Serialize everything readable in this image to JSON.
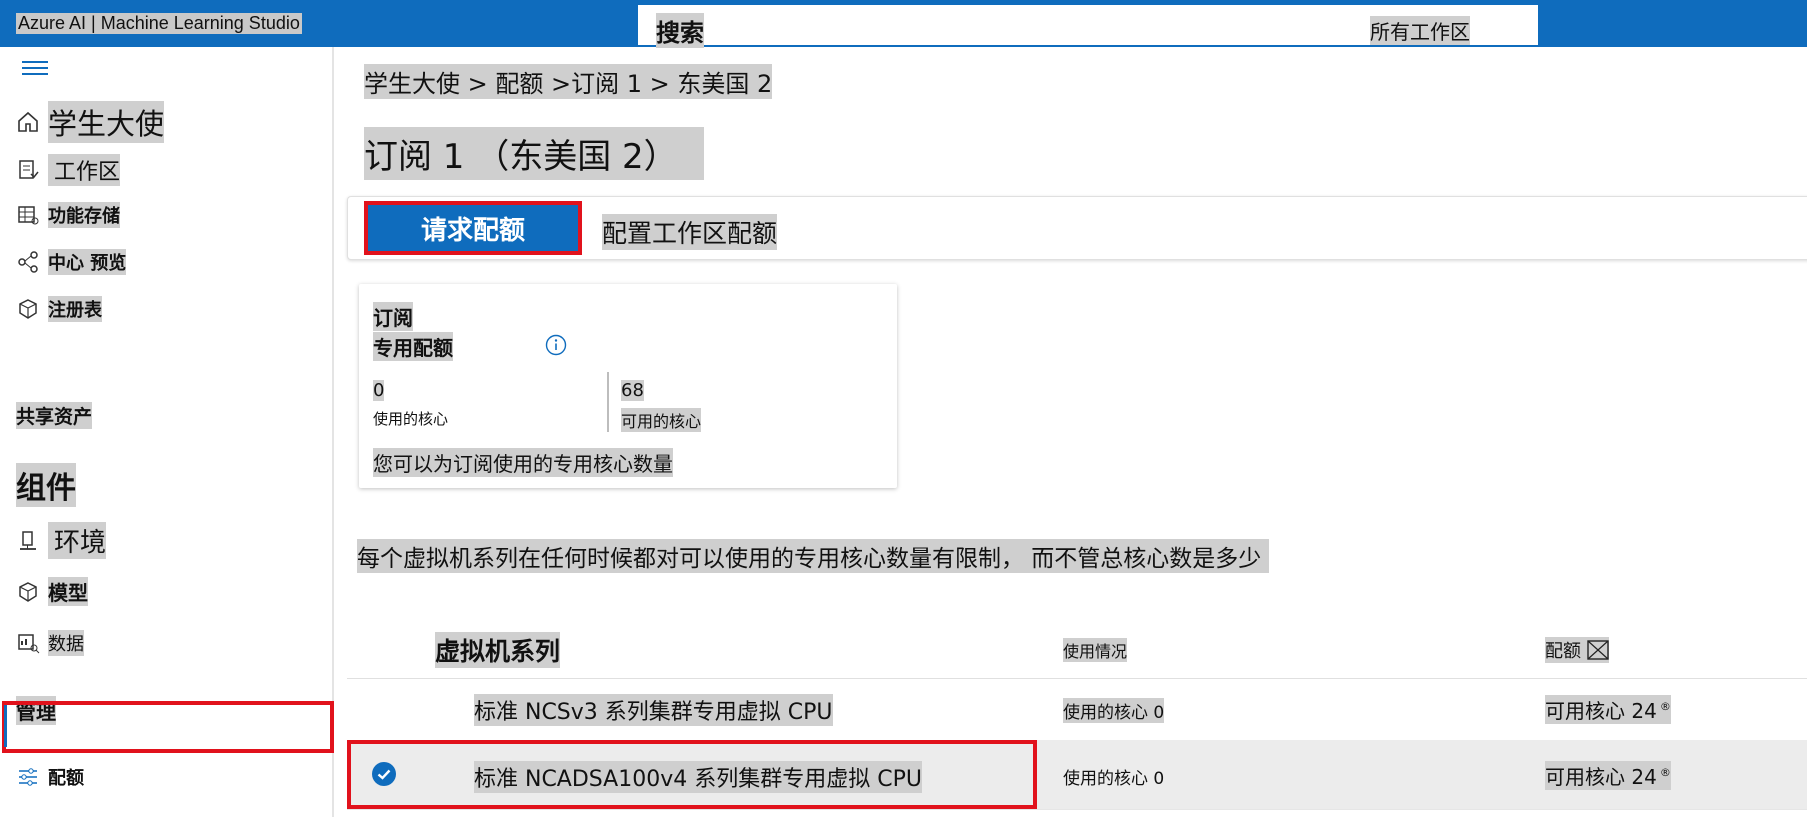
{
  "header": {
    "app_title": "Azure AI | Machine Learning Studio",
    "search_label": "搜索",
    "scope_label": "所有工作区"
  },
  "sidebar": {
    "items": [
      {
        "label": "学生大使",
        "icon": "home-icon"
      },
      {
        "label": "工作区",
        "icon": "workspace-icon"
      },
      {
        "label": "功能存储",
        "icon": "feature-store-icon"
      },
      {
        "label": "中心 预览",
        "icon": "hub-icon"
      },
      {
        "label": "注册表",
        "icon": "registry-icon"
      }
    ],
    "section_shared": "共享资产",
    "section_components": "组件",
    "shared_items": [
      {
        "label": "环境",
        "icon": "environment-icon"
      },
      {
        "label": "模型",
        "icon": "model-icon"
      },
      {
        "label": "数据",
        "icon": "data-icon"
      }
    ],
    "section_manage": "管理",
    "manage_items": [
      {
        "label": "配额",
        "icon": "quota-sliders-icon",
        "selected": true
      }
    ]
  },
  "breadcrumb": "学生大使 > 配额 >订阅 1 > 东美国 2",
  "page_title": "订阅 1 （东美国 2）",
  "toolbar": {
    "request_quota_label": "请求配额",
    "configure_workspace_quota_label": "配置工作区配额"
  },
  "card": {
    "title": "订阅",
    "subtitle": "专用配额",
    "used_value": "0",
    "used_label": "使用的核心",
    "available_value": "68",
    "available_label": "可用的核心",
    "note": "您可以为订阅使用的专用核心数量"
  },
  "limit_text": "每个虚拟机系列在任何时候都对可以使用的专用核心数量有限制， 而不管总核心数是多少",
  "table": {
    "headers": {
      "family": "虚拟机系列",
      "usage": "使用情况",
      "quota": "配额"
    },
    "rows": [
      {
        "family": "标准 NCSv3 系列集群专用虚拟 CPU",
        "usage": "使用的核心 0",
        "quota": "可用核心 24",
        "selected": false
      },
      {
        "family": "标准 NCADSA100v4 系列集群专用虚拟 CPU",
        "usage": "使用的核心 0",
        "quota": "可用核心 24",
        "selected": true
      }
    ]
  },
  "colors": {
    "brand_blue": "#0f6cbd",
    "highlight_red": "#e1121c"
  }
}
